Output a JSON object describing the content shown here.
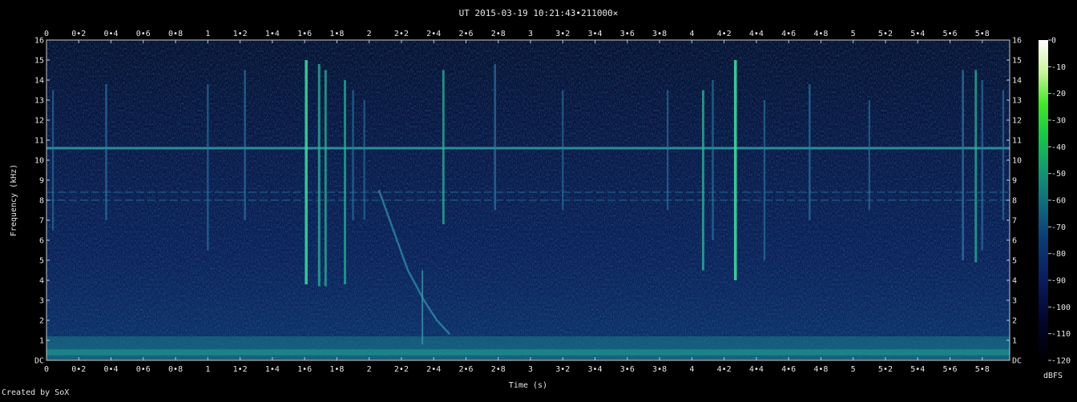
{
  "title": "UT 2015-03-19 10:21:43•211000×",
  "credit": "Created by SoX",
  "chart_data": {
    "type": "heatmap",
    "title": "UT 2015-03-19 10:21:43•211000×",
    "xlabel": "Time (s)",
    "ylabel": "Frequency (kHz)",
    "xlim": [
      0,
      5.97
    ],
    "ylim": [
      0,
      16
    ],
    "x_ticks": [
      "0",
      "0•2",
      "0•4",
      "0•6",
      "0•8",
      "1",
      "1•2",
      "1•4",
      "1•6",
      "1•8",
      "2",
      "2•2",
      "2•4",
      "2•6",
      "2•8",
      "3",
      "3•2",
      "3•4",
      "3•6",
      "3•8",
      "4",
      "4•2",
      "4•4",
      "4•6",
      "4•8",
      "5",
      "5•2",
      "5•4",
      "5•6",
      "5•8"
    ],
    "y_ticks": [
      "DC",
      "1",
      "2",
      "3",
      "4",
      "5",
      "6",
      "7",
      "8",
      "9",
      "10",
      "11",
      "12",
      "13",
      "14",
      "15",
      "16"
    ],
    "colorbar": {
      "label": "dBFS",
      "ticks": [
        "0",
        "-10",
        "-20",
        "-30",
        "-40",
        "-50",
        "-60",
        "-70",
        "-80",
        "-90",
        "-100",
        "-110",
        "-120"
      ],
      "range": [
        -120,
        0
      ]
    },
    "features": {
      "horizontal_lines_khz": [
        10.6,
        8.4,
        8.0
      ],
      "low_band_khz": [
        0,
        1.2
      ],
      "vertical_bursts": [
        {
          "t": 0.04,
          "fmin": 6.5,
          "fmax": 13.5,
          "strength": 0.3
        },
        {
          "t": 0.37,
          "fmin": 7.0,
          "fmax": 13.8,
          "strength": 0.4
        },
        {
          "t": 1.0,
          "fmin": 5.5,
          "fmax": 13.8,
          "strength": 0.35
        },
        {
          "t": 1.23,
          "fmin": 7.0,
          "fmax": 14.5,
          "strength": 0.4
        },
        {
          "t": 1.61,
          "fmin": 3.8,
          "fmax": 15.0,
          "strength": 0.8
        },
        {
          "t": 1.69,
          "fmin": 3.7,
          "fmax": 14.8,
          "strength": 0.6
        },
        {
          "t": 1.73,
          "fmin": 3.7,
          "fmax": 14.5,
          "strength": 0.55
        },
        {
          "t": 1.85,
          "fmin": 3.8,
          "fmax": 14.0,
          "strength": 0.55
        },
        {
          "t": 1.9,
          "fmin": 7.0,
          "fmax": 13.5,
          "strength": 0.35
        },
        {
          "t": 1.97,
          "fmin": 7.0,
          "fmax": 13.0,
          "strength": 0.3
        },
        {
          "t": 2.46,
          "fmin": 6.8,
          "fmax": 14.5,
          "strength": 0.55
        },
        {
          "t": 2.78,
          "fmin": 7.5,
          "fmax": 14.8,
          "strength": 0.45
        },
        {
          "t": 3.2,
          "fmin": 7.5,
          "fmax": 13.5,
          "strength": 0.3
        },
        {
          "t": 3.85,
          "fmin": 7.5,
          "fmax": 13.5,
          "strength": 0.3
        },
        {
          "t": 4.07,
          "fmin": 4.5,
          "fmax": 13.5,
          "strength": 0.6
        },
        {
          "t": 4.13,
          "fmin": 6.0,
          "fmax": 14.0,
          "strength": 0.4
        },
        {
          "t": 4.27,
          "fmin": 4.0,
          "fmax": 15.0,
          "strength": 0.85
        },
        {
          "t": 4.45,
          "fmin": 5.0,
          "fmax": 13.0,
          "strength": 0.35
        },
        {
          "t": 4.73,
          "fmin": 7.0,
          "fmax": 13.8,
          "strength": 0.4
        },
        {
          "t": 5.1,
          "fmin": 7.5,
          "fmax": 13.0,
          "strength": 0.3
        },
        {
          "t": 5.68,
          "fmin": 5.0,
          "fmax": 14.5,
          "strength": 0.5
        },
        {
          "t": 5.76,
          "fmin": 4.9,
          "fmax": 14.5,
          "strength": 0.55
        },
        {
          "t": 5.8,
          "fmin": 5.5,
          "fmax": 14.0,
          "strength": 0.4
        },
        {
          "t": 5.93,
          "fmin": 7.0,
          "fmax": 13.5,
          "strength": 0.35
        }
      ],
      "sweep": [
        {
          "t": 2.06,
          "f": 8.5
        },
        {
          "t": 2.15,
          "f": 6.5
        },
        {
          "t": 2.24,
          "f": 4.5
        },
        {
          "t": 2.34,
          "f": 3.0
        },
        {
          "t": 2.42,
          "f": 2.0
        },
        {
          "t": 2.5,
          "f": 1.3
        }
      ],
      "short_spike": {
        "t": 2.33,
        "fmin": 0.8,
        "fmax": 4.5,
        "strength": 0.4
      }
    }
  },
  "colors": {
    "background": "#000000",
    "plot_base": "#0b1a4a",
    "text": "#e6e6e6",
    "axis": "#c8c8c8"
  }
}
